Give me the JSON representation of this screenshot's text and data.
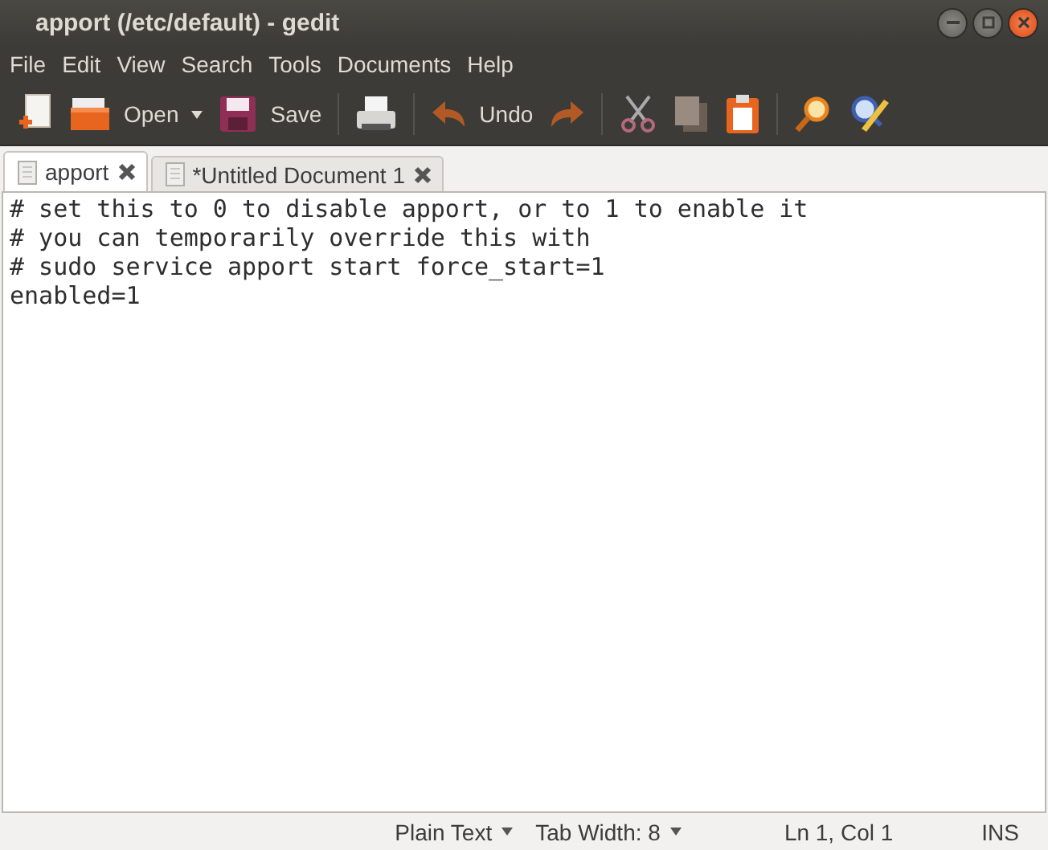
{
  "window": {
    "title": "apport (/etc/default) - gedit"
  },
  "menu": [
    "File",
    "Edit",
    "View",
    "Search",
    "Tools",
    "Documents",
    "Help"
  ],
  "toolbar": [
    {
      "kind": "button",
      "dropdown": false
    },
    {
      "kind": "button",
      "label": "Open",
      "dropdown": true
    },
    {
      "kind": "button",
      "label": "Save",
      "dropdown": false
    },
    {
      "kind": "separator"
    },
    {
      "kind": "button",
      "dropdown": false
    },
    {
      "kind": "separator"
    },
    {
      "kind": "button",
      "label": "Undo",
      "dropdown": false
    },
    {
      "kind": "button",
      "dropdown": false
    },
    {
      "kind": "separator"
    },
    {
      "kind": "button",
      "dropdown": false
    },
    {
      "kind": "button",
      "dropdown": false
    },
    {
      "kind": "button",
      "dropdown": false
    },
    {
      "kind": "separator"
    },
    {
      "kind": "button",
      "dropdown": false
    },
    {
      "kind": "button",
      "dropdown": false
    }
  ],
  "tabs": [
    {
      "label": "apport",
      "selected": true
    },
    {
      "label": "*Untitled Document 1",
      "selected": false
    }
  ],
  "editor": {
    "lines": [
      "# set this to 0 to disable apport, or to 1 to enable it",
      "# you can temporarily override this with",
      "# sudo service apport start force_start=1",
      "enabled=1"
    ]
  },
  "status_bar": [
    {
      "text": "Plain Text",
      "dropdown": true
    },
    {
      "text": "Tab Width:  8",
      "dropdown": true
    },
    {
      "text": "Ln 1, Col 1",
      "dropdown": false
    },
    {
      "text": "INS",
      "dropdown": false
    }
  ]
}
